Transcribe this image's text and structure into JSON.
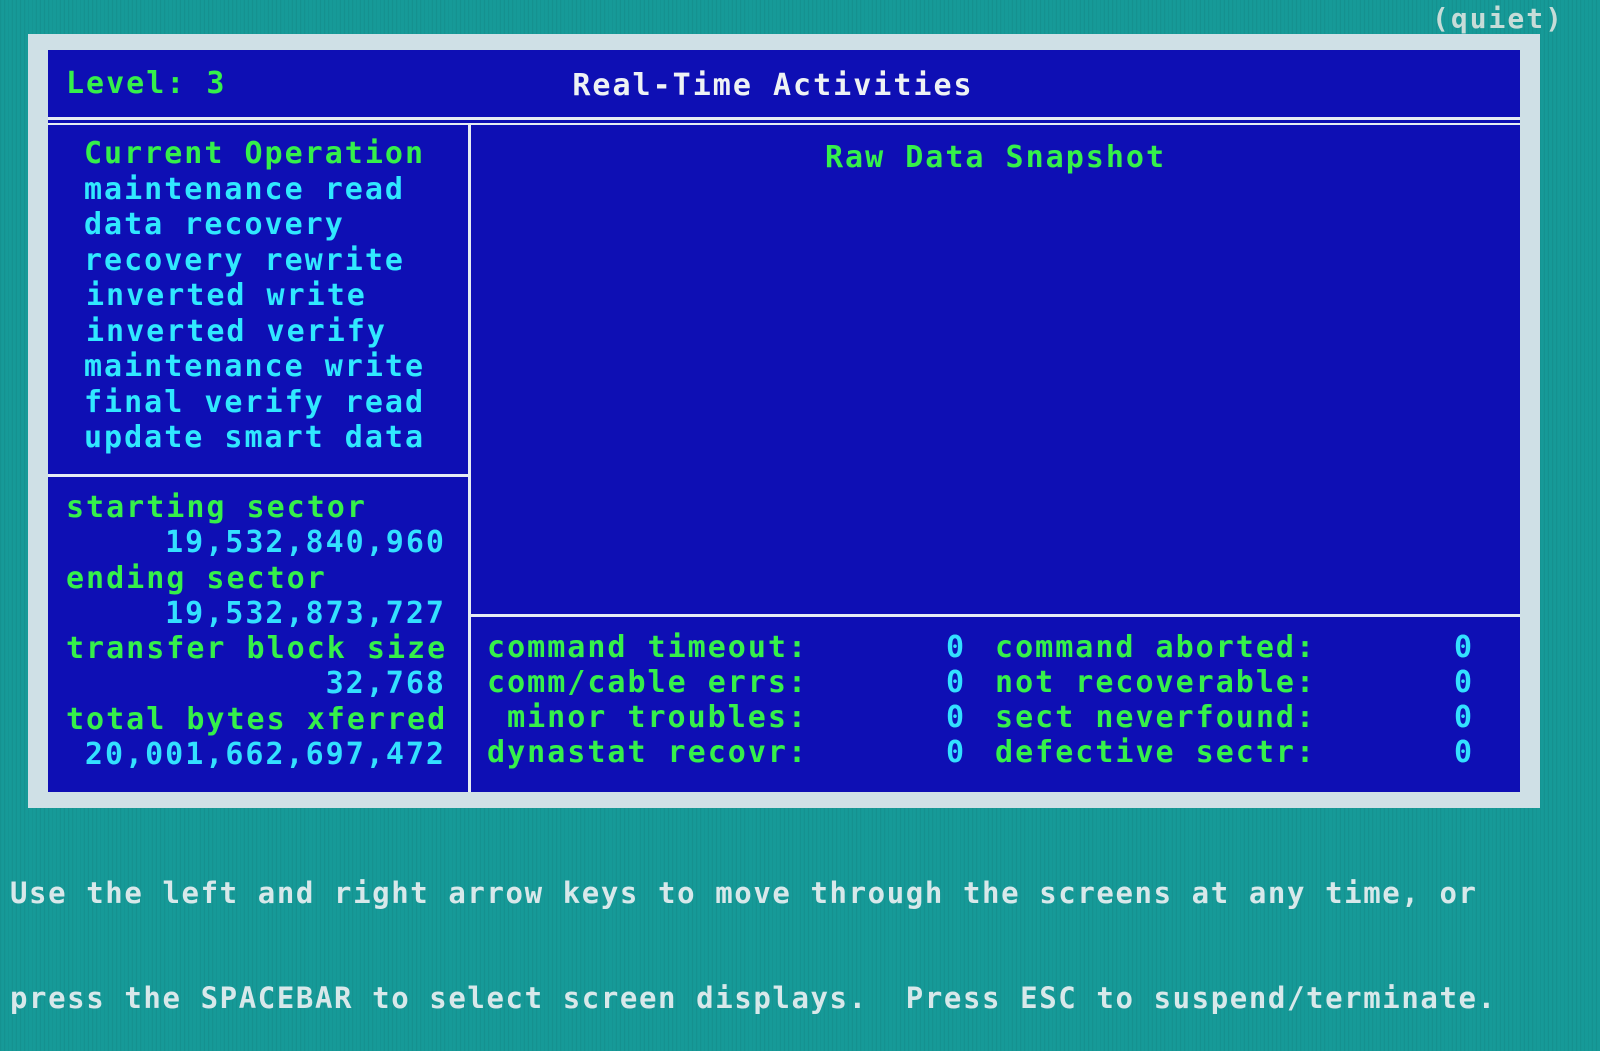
{
  "mode": "(quiet)",
  "header": {
    "level_label": "Level: 3",
    "title": "Real-Time Activities"
  },
  "operations": {
    "heading": "Current Operation",
    "items": [
      "maintenance read",
      "data recovery",
      "recovery rewrite",
      "inverted write",
      "inverted verify",
      "maintenance write",
      "final verify read",
      "update smart data"
    ]
  },
  "stats": [
    {
      "label": "starting sector",
      "value": "19,532,840,960"
    },
    {
      "label": "ending sector",
      "value": "19,532,873,727"
    },
    {
      "label": "transfer block size",
      "value": "32,768"
    },
    {
      "label": "total bytes xferred",
      "value": "20,001,662,697,472"
    }
  ],
  "snapshot": {
    "title": "Raw Data Snapshot"
  },
  "errors": {
    "left": [
      {
        "label": "command timeout:",
        "value": "0"
      },
      {
        "label": "comm/cable errs:",
        "value": "0"
      },
      {
        "label": "minor troubles:",
        "value": "0"
      },
      {
        "label": "dynastat recovr:",
        "value": "0"
      }
    ],
    "right": [
      {
        "label": "command aborted:",
        "value": "0"
      },
      {
        "label": "not recoverable:",
        "value": "0"
      },
      {
        "label": "sect neverfound:",
        "value": "0"
      },
      {
        "label": "defective sectr:",
        "value": "0"
      }
    ]
  },
  "footer": {
    "line1": "Use the left and right arrow keys to move through the screens at any time, or",
    "line2": "press the SPACEBAR to select screen displays.  Press ESC to suspend/terminate."
  }
}
